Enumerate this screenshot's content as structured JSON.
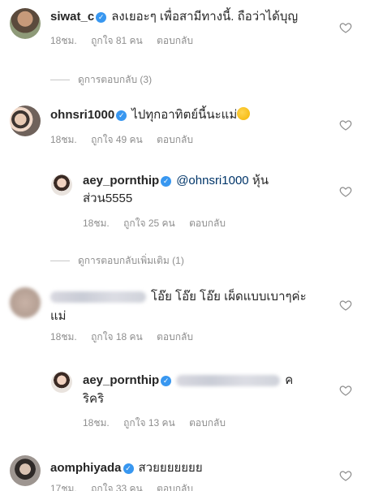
{
  "comments": [
    {
      "username": "siwat_c",
      "text": "ลงเยอะๆ เพื่อสามีทางนี้. ถือว่าได้บุญ",
      "time": "18ชม.",
      "likes": "ถูกใจ 81 คน",
      "reply": "ตอบกลับ"
    },
    {
      "username": "ohnsri1000",
      "text": "ไปทุกอาทิตย์นี้นะแม่",
      "time": "18ชม.",
      "likes": "ถูกใจ 49 คน",
      "reply": "ตอบกลับ"
    },
    {
      "username": "aey_pornthip",
      "mention": "@ohnsri1000",
      "text_a": "หุ้น",
      "text_b": "ส่วน5555",
      "time": "18ชม.",
      "likes": "ถูกใจ 25 คน",
      "reply": "ตอบกลับ"
    },
    {
      "text_a": "โอ๊ย โอ๊ย โอ๊ย เผ็ดแบบเบาๆค่ะ",
      "text_b": "แม่",
      "time": "18ชม.",
      "likes": "ถูกใจ 18 คน",
      "reply": "ตอบกลับ"
    },
    {
      "username": "aey_pornthip",
      "text_a": "ค",
      "text_b": "ริคริ",
      "time": "18ชม.",
      "likes": "ถูกใจ 13 คน",
      "reply": "ตอบกลับ"
    },
    {
      "username": "aomphiyada",
      "text": "สวยยยยยยย",
      "time": "17ชม.",
      "likes": "ถูกใจ 33 คน",
      "reply": "ตอบกลับ"
    }
  ],
  "view_replies_1": "ดูการตอบกลับ (3)",
  "view_replies_2": "ดูการตอบกลับเพิ่มเติม (1)",
  "icons": {
    "verified": "verified-badge-icon",
    "like": "heart-outline-icon"
  },
  "colors": {
    "verified": "#3897f0",
    "meta": "#8e8e8e",
    "text": "#262626"
  }
}
